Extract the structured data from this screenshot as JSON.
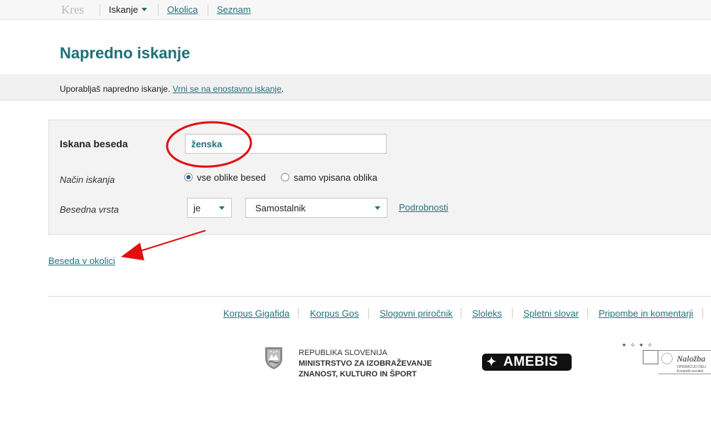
{
  "nav": {
    "brand": "Kres",
    "active": "Iskanje",
    "links": [
      "Okolica",
      "Seznam"
    ]
  },
  "page_title": "Napredno iskanje",
  "info": {
    "text": "Uporabljaš napredno iskanje. ",
    "link": "Vrni se na enostavno iskanje",
    "suffix": "."
  },
  "form": {
    "word_label": "Iskana beseda",
    "word_value": "ženska",
    "mode_label": "Način iskanja",
    "mode_options": [
      "vse oblike besed",
      "samo vpisana oblika"
    ],
    "mode_selected": "vse oblike besed",
    "pos_label": "Besedna vrsta",
    "pos_operator": "je",
    "pos_value": "Samostalnik",
    "details_link": "Podrobnosti"
  },
  "context_link": "Beseda v okolici",
  "footer": {
    "links": [
      "Korpus Gigafida",
      "Korpus Gos",
      "Slogovni priročnik",
      "Sloleks",
      "Spletni slovar",
      "Pripombe in komentarji"
    ]
  },
  "logos": {
    "gov_line1": "REPUBLIKA SLOVENIJA",
    "gov_line2": "MINISTRSTVO ZA IZOBRAŽEVANJE",
    "gov_line3": "ZNANOST, KULTURO IN ŠPORT",
    "amebis": "AMEBIS",
    "eu_title": "Naložba",
    "eu_small1": "OPERACIJO DELI",
    "eu_small2": "Evropski socialni"
  },
  "colors": {
    "accent": "#1f6f78",
    "link": "#23737a",
    "annotation": "#e01010"
  }
}
